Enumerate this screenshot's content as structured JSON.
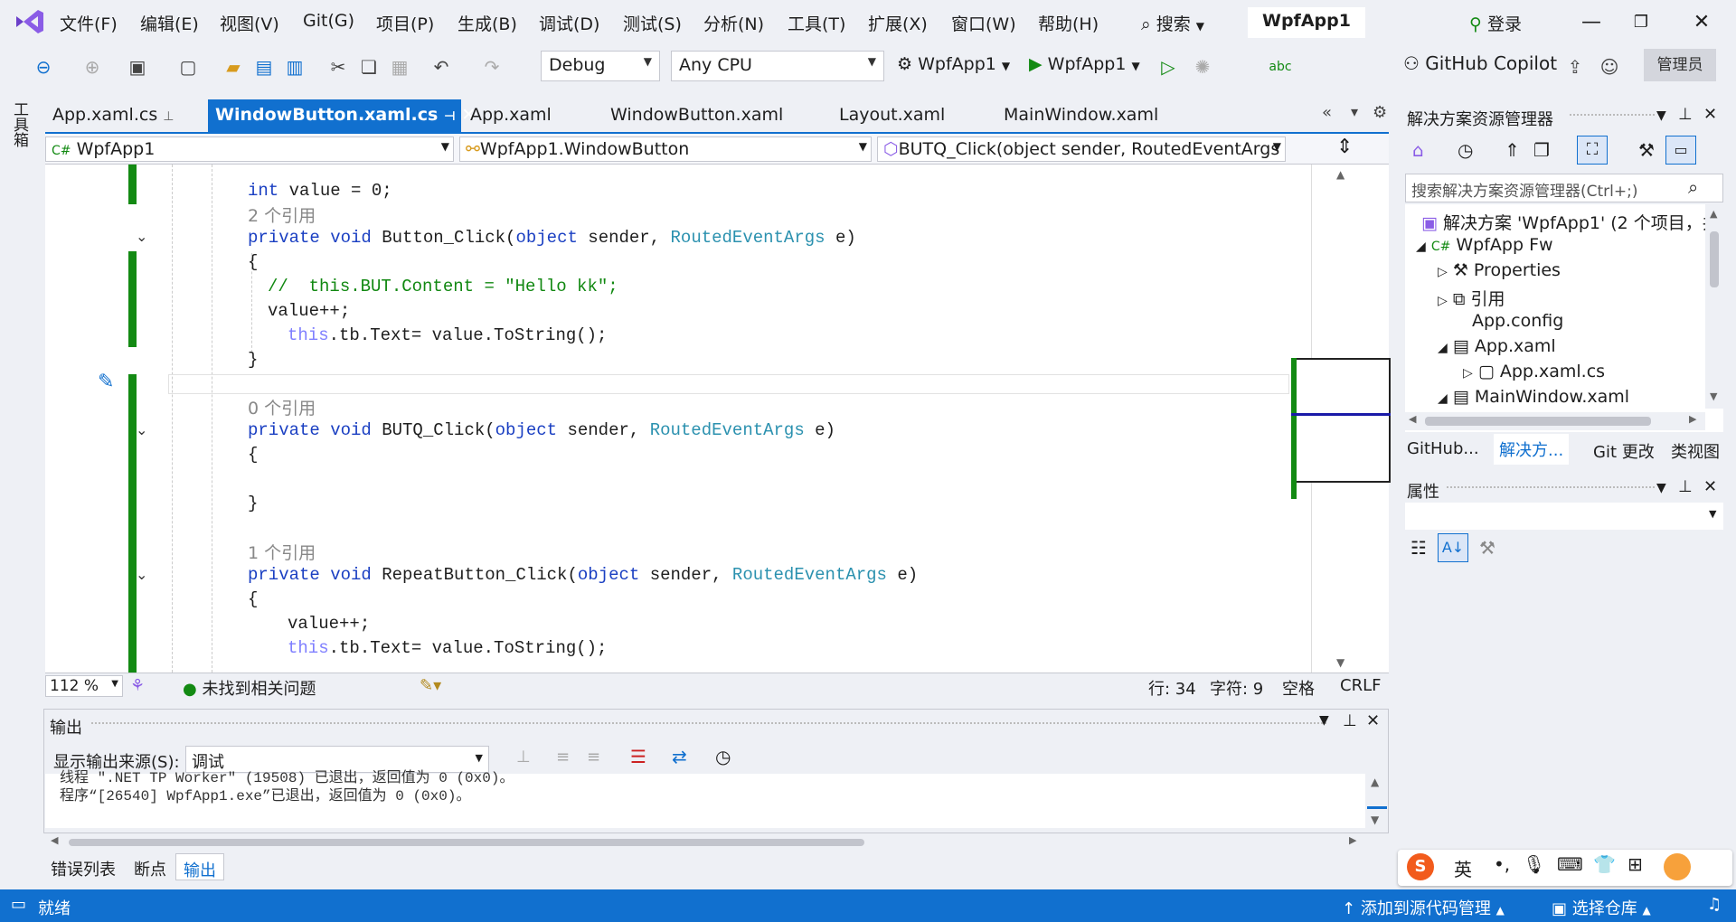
{
  "menu": [
    "文件(F)",
    "编辑(E)",
    "视图(V)",
    "Git(G)",
    "项目(P)",
    "生成(B)",
    "调试(D)",
    "测试(S)",
    "分析(N)",
    "工具(T)",
    "扩展(X)",
    "窗口(W)",
    "帮助(H)"
  ],
  "search_label": "搜索",
  "app_title": "WpfApp1",
  "login_label": "登录",
  "toolbar": {
    "config": "Debug",
    "platform": "Any CPU",
    "startup_project": "WpfApp1",
    "run_target": "WpfApp1",
    "copilot": "GitHub Copilot",
    "admin": "管理员"
  },
  "left_toolbox": "工具箱",
  "tabs": [
    "App.xaml.cs",
    "WindowButton.xaml.cs",
    "App.xaml",
    "WindowButton.xaml",
    "Layout.xaml",
    "MainWindow.xaml"
  ],
  "nav": {
    "project": "WpfApp1",
    "class": "WpfApp1.WindowButton",
    "member": "BUTQ_Click(object sender, RoutedEventArgs e)"
  },
  "code": {
    "l1_kw": "int",
    "l1_rest": " value = 0;",
    "ref2": "2 个引用",
    "l3_kw": "private void",
    "l3_name": " Button_Click(",
    "l3_kw2": "object",
    "l3_a": " sender, ",
    "l3_ty": "RoutedEventArgs",
    "l3_b": " e)",
    "brace_open": "{",
    "brace_close": "}",
    "comment": "//  this.BUT.Content = \"Hello kk\";",
    "inc": "value++;",
    "this_kw": "this",
    "tbtext": ".tb.Text= value.ToString();",
    "ref0": "0 个引用",
    "l10_name": " BUTQ_Click(",
    "ref1": "1 个引用",
    "l15_name": " RepeatButton_Click("
  },
  "editor_status": {
    "zoom": "112 %",
    "issues": "未找到相关问题",
    "line": "行: 34",
    "char": "字符: 9",
    "ws": "空格",
    "eol": "CRLF"
  },
  "output": {
    "title": "输出",
    "source_label": "显示输出来源(S):",
    "source_value": "调试",
    "line1": "线程 \".NET TP Worker\" (19508) 已退出，返回值为 0 (0x0)。",
    "line2": "程序“[26540] WpfApp1.exe”已退出，返回值为 0 (0x0)。"
  },
  "bottom_tabs": [
    "错误列表",
    "断点",
    "输出"
  ],
  "solution": {
    "title": "解决方案资源管理器",
    "search_placeholder": "搜索解决方案资源管理器(Ctrl+;)",
    "items": [
      "解决方案 'WpfApp1' (2 个项目，共",
      "WpfApp Fw",
      "Properties",
      "引用",
      "App.config",
      "App.xaml",
      "App.xaml.cs",
      "MainWindow.xaml"
    ],
    "tabs": [
      "GitHub...",
      "解决方...",
      "Git 更改",
      "类视图"
    ]
  },
  "properties": {
    "title": "属性"
  },
  "ime": {
    "lang": "英"
  },
  "status": {
    "ready": "就绪",
    "add_source": "添加到源代码管理",
    "choose_repo": "选择仓库"
  },
  "colors": {
    "accent": "#1170cf",
    "change_bar": "#138a13"
  }
}
